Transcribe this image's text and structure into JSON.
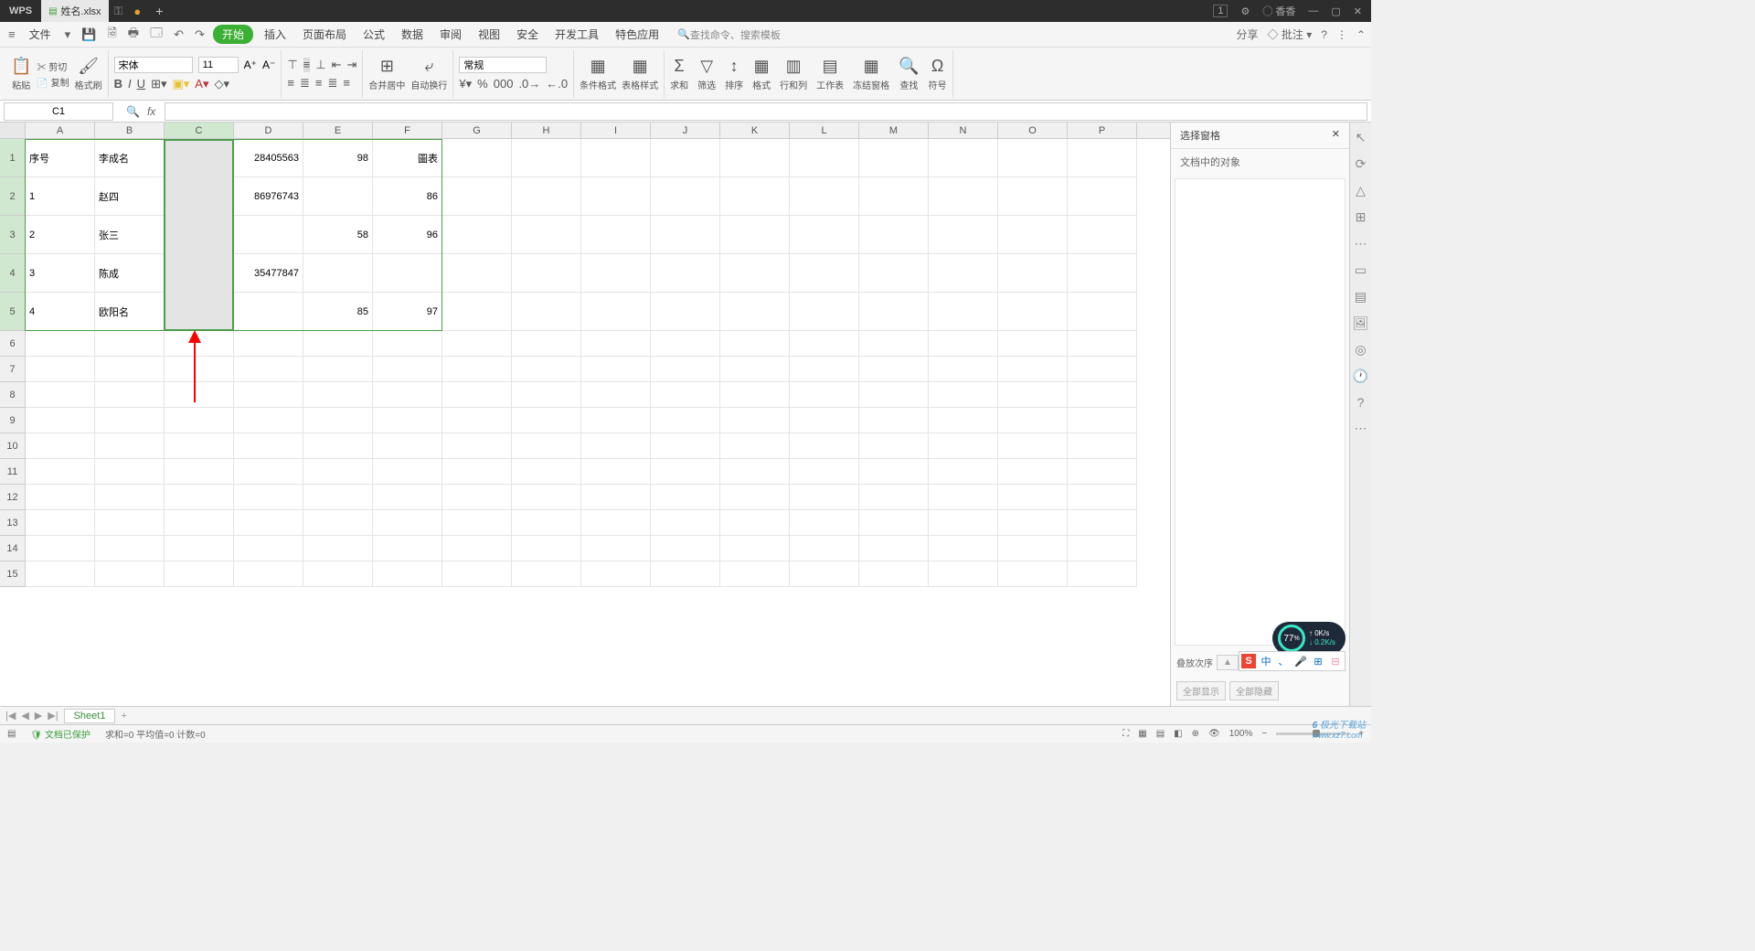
{
  "titlebar": {
    "logo": "WPS",
    "tab_name": "姓名.xlsx",
    "tab_indicator": "⚿",
    "tab_dot": "●",
    "plus": "+",
    "right_badge": "1",
    "user": "香香"
  },
  "menubar": {
    "file": "文件",
    "items": [
      "开始",
      "插入",
      "页面布局",
      "公式",
      "数据",
      "审阅",
      "视图",
      "安全",
      "开发工具",
      "特色应用"
    ],
    "search_placeholder": "查找命令、搜索模板",
    "share": "分享",
    "comment": "批注"
  },
  "ribbon": {
    "paste": "粘贴",
    "cut": "剪切",
    "copy": "复制",
    "format_painter": "格式刷",
    "font_name": "宋体",
    "font_size": "11",
    "merge": "合并居中",
    "wrap": "自动换行",
    "number_format": "常规",
    "cond_format": "条件格式",
    "table_style": "表格样式",
    "sum": "求和",
    "filter": "筛选",
    "sort": "排序",
    "format": "格式",
    "rowcol": "行和列",
    "sheet": "工作表",
    "freeze": "冻结窗格",
    "find": "查找",
    "symbol": "符号"
  },
  "namebox": "C1",
  "columns": [
    "A",
    "B",
    "C",
    "D",
    "E",
    "F",
    "G",
    "H",
    "I",
    "J",
    "K",
    "L",
    "M",
    "N",
    "O",
    "P"
  ],
  "selected_col": "C",
  "rows": [
    {
      "n": "1",
      "sel": true,
      "A": "序号",
      "B": "李成名",
      "C": "",
      "D": "28405563",
      "E": "98",
      "F": "圖表"
    },
    {
      "n": "2",
      "sel": true,
      "A": "1",
      "B": "赵四",
      "C": "",
      "D": "86976743",
      "E": "",
      "F": "86"
    },
    {
      "n": "3",
      "sel": true,
      "A": "2",
      "B": "张三",
      "C": "",
      "D": "",
      "E": "58",
      "F": "96"
    },
    {
      "n": "4",
      "sel": true,
      "A": "3",
      "B": "陈成",
      "C": "",
      "D": "35477847",
      "E": "",
      "F": ""
    },
    {
      "n": "5",
      "sel": true,
      "A": "4",
      "B": "欧阳名",
      "C": "",
      "D": "",
      "E": "85",
      "F": "97"
    },
    {
      "n": "6"
    },
    {
      "n": "7"
    },
    {
      "n": "8"
    },
    {
      "n": "9"
    },
    {
      "n": "10"
    },
    {
      "n": "11"
    },
    {
      "n": "12"
    },
    {
      "n": "13"
    },
    {
      "n": "14"
    },
    {
      "n": "15"
    }
  ],
  "sidepanel": {
    "title": "选择窗格",
    "sub": "文档中的对象",
    "stack": "叠放次序",
    "show_all": "全部显示",
    "hide_all": "全部隐藏"
  },
  "sheettabs": {
    "sheet1": "Sheet1"
  },
  "statusbar": {
    "protect": "文档已保护",
    "stats": "求和=0  平均值=0  计数=0",
    "zoom": "100%"
  },
  "meter": {
    "pct": "77",
    "unit": "%",
    "up": "0K/s",
    "down": "0.2K/s"
  },
  "ime": [
    "S",
    "中",
    "、",
    "🎤",
    "⊞",
    "⊟"
  ],
  "watermark": {
    "brand": "极光下载站",
    "url": "www.xz7.com"
  }
}
